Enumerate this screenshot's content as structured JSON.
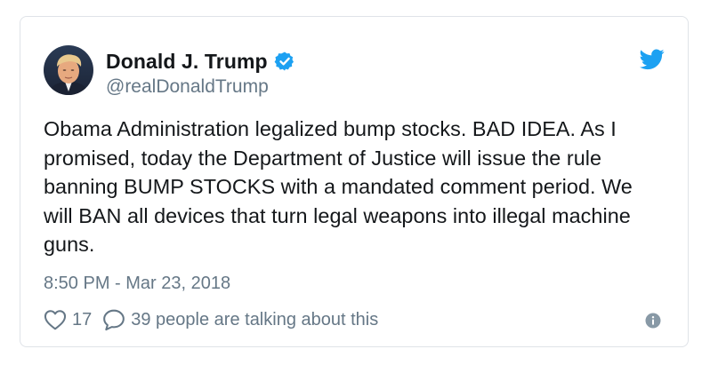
{
  "author": {
    "display_name": "Donald J. Trump",
    "handle": "@realDonaldTrump"
  },
  "tweet": {
    "text": "Obama Administration legalized bump stocks. BAD IDEA. As I\npromised, today the Department of Justice will issue the rule\nbanning BUMP STOCKS with a mandated comment period. We\nwill BAN all devices that turn legal weapons into illegal machine\nguns.",
    "timestamp": "8:50 PM - Mar 23, 2018"
  },
  "actions": {
    "like_count": "17",
    "talking_text": "39 people are talking about this"
  },
  "icons": {
    "verified": "verified-badge-icon",
    "brand": "twitter-bird-icon",
    "like": "heart-icon",
    "reply": "speech-bubble-icon",
    "info": "info-icon"
  },
  "colors": {
    "accent": "#1da1f2",
    "text": "#14171a",
    "secondary_text": "#657786",
    "border": "#dfe3e8"
  }
}
